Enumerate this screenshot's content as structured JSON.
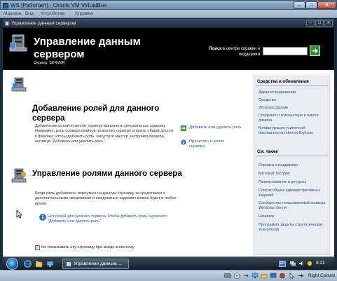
{
  "vbox": {
    "title": "WS [Работает] - Oracle VM VirtualBox",
    "menu": [
      "Машина",
      "Вид",
      "Устройства",
      "Справка"
    ],
    "window_controls": {
      "minimize": "–",
      "maximize": "□",
      "close": "✕"
    },
    "host_key": "Right Control"
  },
  "guest_window": {
    "title": "Управление данным сервером",
    "controls": {
      "minimize": "–",
      "maximize": "□",
      "close": "✕"
    }
  },
  "header": {
    "title": "Управление данным сервером",
    "server_label": "Сервер: SERVER",
    "search_caption_bold": "Поиск",
    "search_caption_rest": " в центре справки и поддержки"
  },
  "section_roles": {
    "title": "Добавление ролей для данного сервера",
    "description": "Добавление ролей позволит серверу выполнять специальные задания. Например, роль сервера файлов позволяет серверу открыть общий доступ к файлам. Чтобы добавить роль, запустите мастер настройки сервера, щелкнув \"Добавить или удалить роль\".",
    "link_add_remove": "Добавить или удалить роль",
    "link_read_about": "Прочитать о ролях сервера"
  },
  "section_manage": {
    "title": "Управление ролями данного сервера",
    "description": "Когда роль добавлена, вернуться на данную страницу за средствами и дополнительными сведениями о ежедневных заданиях можно будет в любое время.",
    "info_text": "Нет ролей для данного сервера. Чтобы добавить роль, щелкните \"Добавить или удалить роль\"."
  },
  "sidebar": {
    "tools_header": "Средства и обновления",
    "tools_links": [
      "Администрирование",
      "Средства",
      "Windows Update",
      "Сведения о компьютере и имени домена",
      "Конфигурация усиленной безопасности Internet Explorer"
    ],
    "see_also_header": "См. также",
    "see_also_links": [
      "Справка и поддержка",
      "Microsoft TechNet",
      "Развертывание и ресурсы",
      "Список общих административных заданий",
      "Сообщество пользователей сервера Windows Server",
      "Новинки",
      "Программа защиты стратегических технологий"
    ]
  },
  "startup": {
    "checkbox_mark": "✓",
    "label": "Не показывать эту страницу при входе в систему"
  },
  "taskbar": {
    "task_label": "Управление данным ...",
    "language": "EN",
    "clock": "8:21"
  },
  "colors": {
    "header_bg": "#000000",
    "link": "#2b58a6",
    "sidebar_bg": "#e7edf3",
    "go_button": "#2f8f34"
  }
}
